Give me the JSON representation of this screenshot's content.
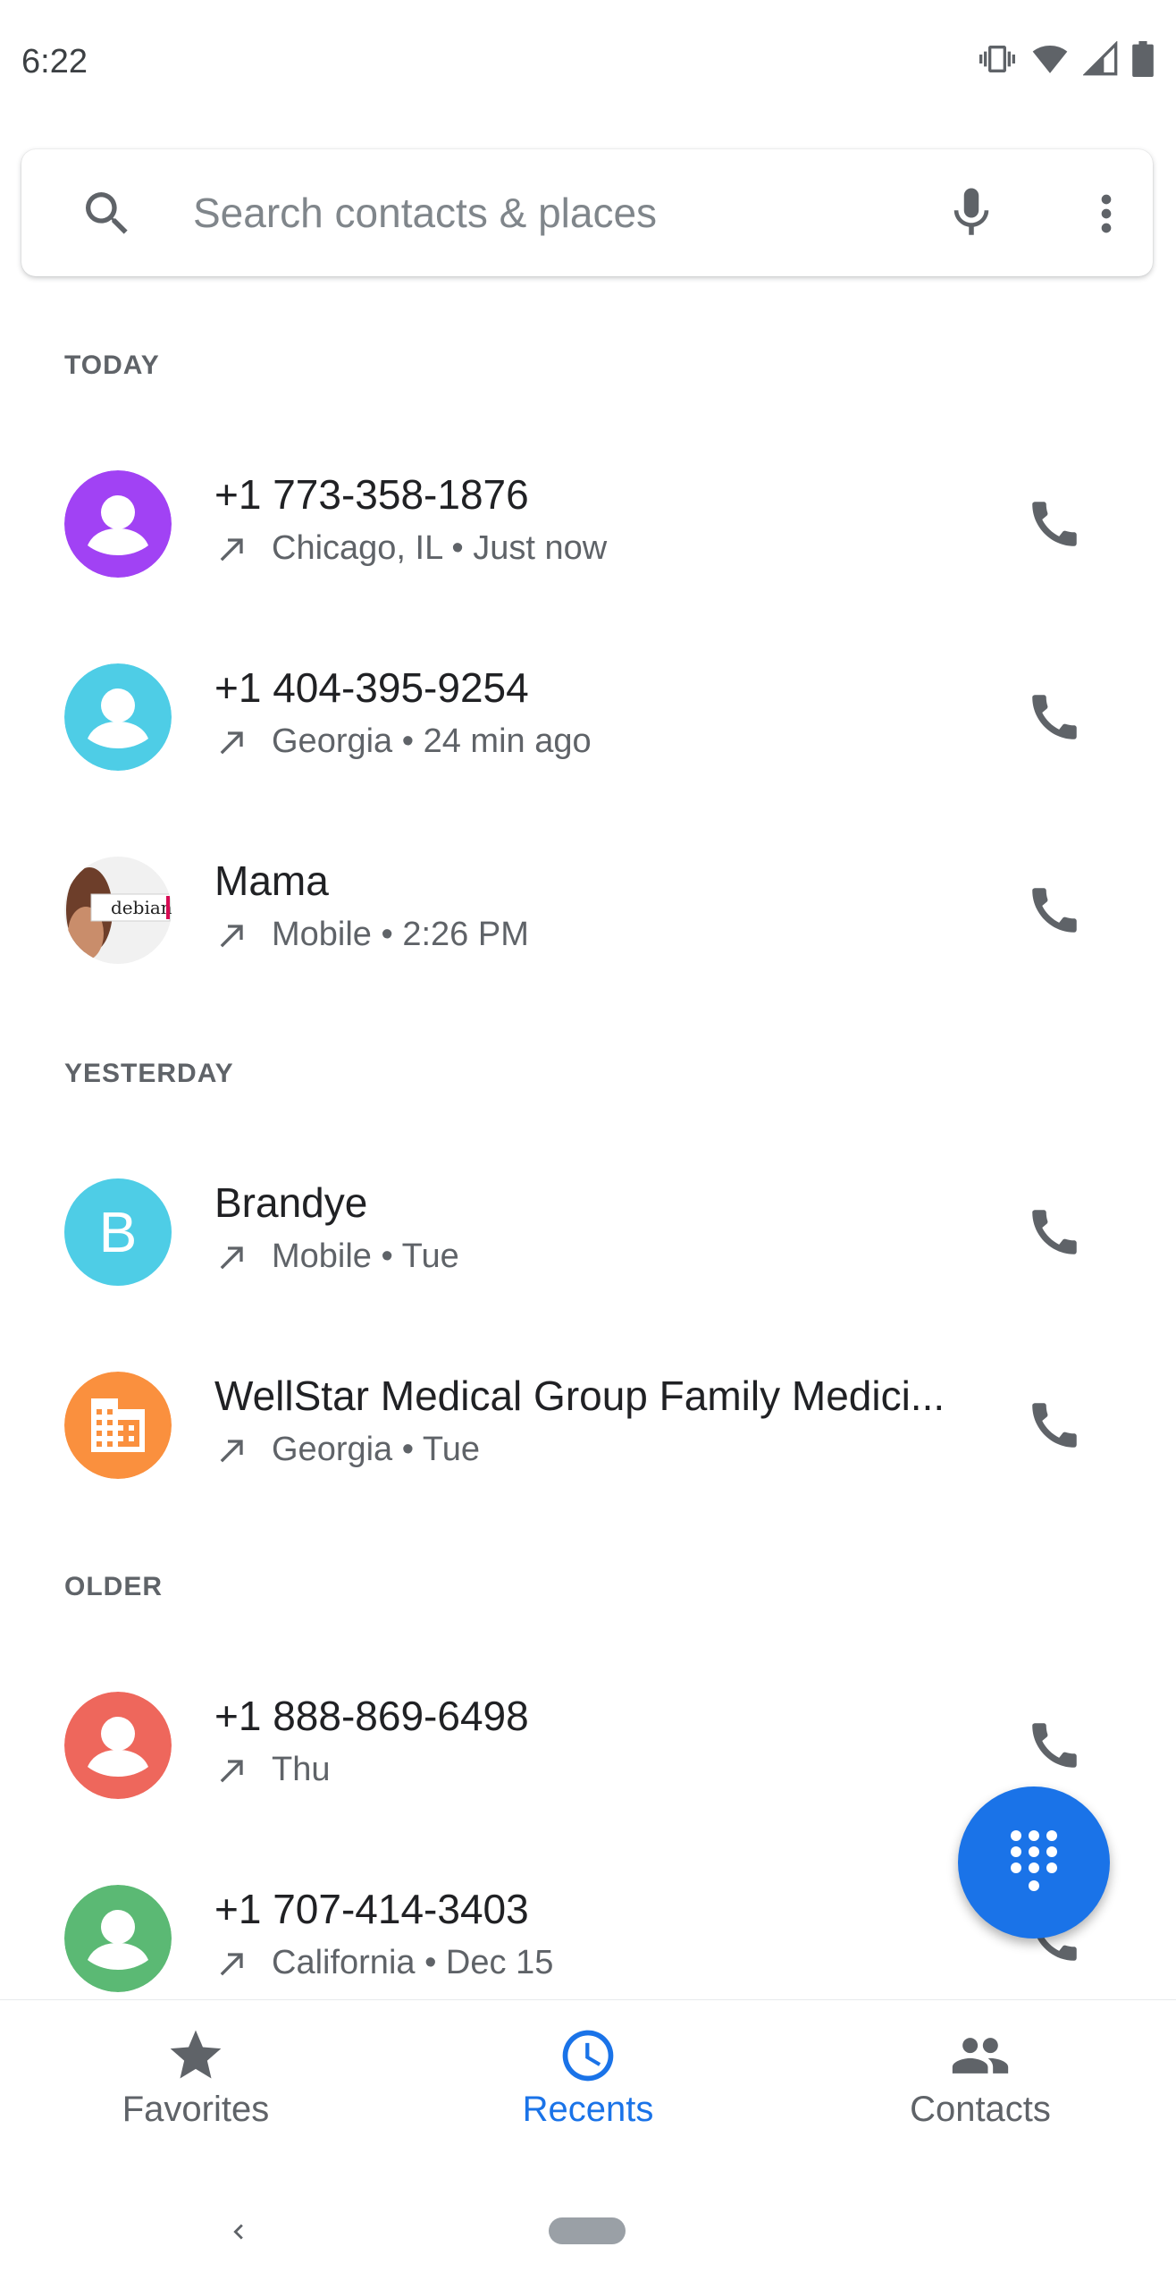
{
  "status_bar": {
    "time": "6:22",
    "icons": [
      "vibrate-icon",
      "wifi-icon",
      "signal-icon",
      "battery-icon"
    ]
  },
  "search": {
    "placeholder": "Search contacts & places"
  },
  "sections": {
    "today": "TODAY",
    "yesterday": "YESTERDAY",
    "older": "OLDER"
  },
  "calls": [
    {
      "name": "+1 773-358-1876",
      "detail": "Chicago, IL • Just now",
      "avatar_type": "person",
      "avatar_color": "#a142f4"
    },
    {
      "name": "+1 404-395-9254",
      "detail": "Georgia • 24 min ago",
      "avatar_type": "person",
      "avatar_color": "#4ecde6"
    },
    {
      "name": "Mama",
      "detail": "Mobile • 2:26 PM",
      "avatar_type": "photo",
      "avatar_photo_text": "debian"
    },
    {
      "name": "Brandye",
      "detail": "Mobile • Tue",
      "avatar_type": "letter",
      "avatar_letter": "B",
      "avatar_color": "#4ecde6"
    },
    {
      "name": "WellStar Medical Group Family Medici...",
      "detail": "Georgia • Tue",
      "avatar_type": "business",
      "avatar_color": "#fa903e"
    },
    {
      "name": "+1 888-869-6498",
      "detail": "Thu",
      "avatar_type": "person",
      "avatar_color": "#ee675c"
    },
    {
      "name": "+1 707-414-3403",
      "detail": "California • Dec 15",
      "avatar_type": "person",
      "avatar_color": "#5bb974"
    }
  ],
  "bottom_nav": {
    "favorites": "Favorites",
    "recents": "Recents",
    "contacts": "Contacts",
    "active": "recents"
  },
  "colors": {
    "accent": "#1a73e8",
    "icon_gray": "#5f6368"
  }
}
